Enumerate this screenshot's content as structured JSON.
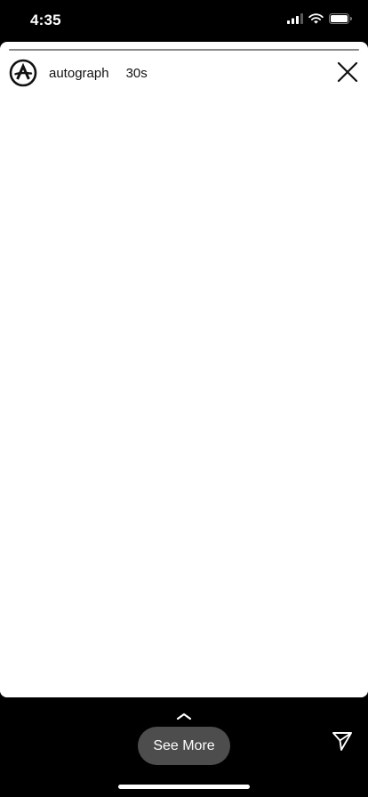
{
  "status_bar": {
    "time": "4:35",
    "icons": [
      "signal-icon",
      "wifi-icon",
      "battery-icon"
    ]
  },
  "story": {
    "progress": 1.0,
    "account": {
      "name": "autograph",
      "avatar_icon": "autograph-logo-icon"
    },
    "age": "30s",
    "close_icon": "close-icon"
  },
  "footer": {
    "see_more_label": "See More",
    "chevron_icon": "chevron-up-icon",
    "share_icon": "send-icon"
  },
  "colors": {
    "background": "#000000",
    "card": "#ffffff",
    "see_more_bg": "#4d4d4d",
    "progress_track": "#bcbcbc",
    "progress_fill": "#8a8a8a"
  }
}
